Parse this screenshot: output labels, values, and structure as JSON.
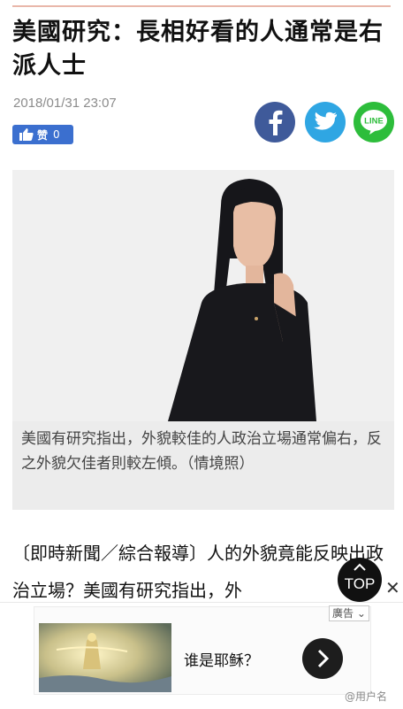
{
  "article": {
    "title": "美國研究：長相好看的人通常是右派人士",
    "date": "2018/01/31 23:07",
    "caption": "美國有研究指出，外貌較佳的人政治立場通常偏右，反之外貌欠佳者則較左傾。（情境照）",
    "body": "〔即時新聞／綜合報導〕人的外貌竟能反映出政治立場？美國有研究指出，外"
  },
  "like": {
    "label": "赞",
    "count": "0"
  },
  "share": {
    "icons": [
      "facebook-icon",
      "twitter-icon",
      "line-icon"
    ],
    "line_label": "LINE"
  },
  "scroll_top": {
    "label": "TOP"
  },
  "ad": {
    "tag": "廣告",
    "text": "谁是耶稣？"
  },
  "watermark": "@用户名",
  "colors": {
    "like_bg": "#3b6fcf",
    "facebook": "#3f5a9a",
    "twitter": "#2fa6e3",
    "line": "#2dbd3b"
  }
}
